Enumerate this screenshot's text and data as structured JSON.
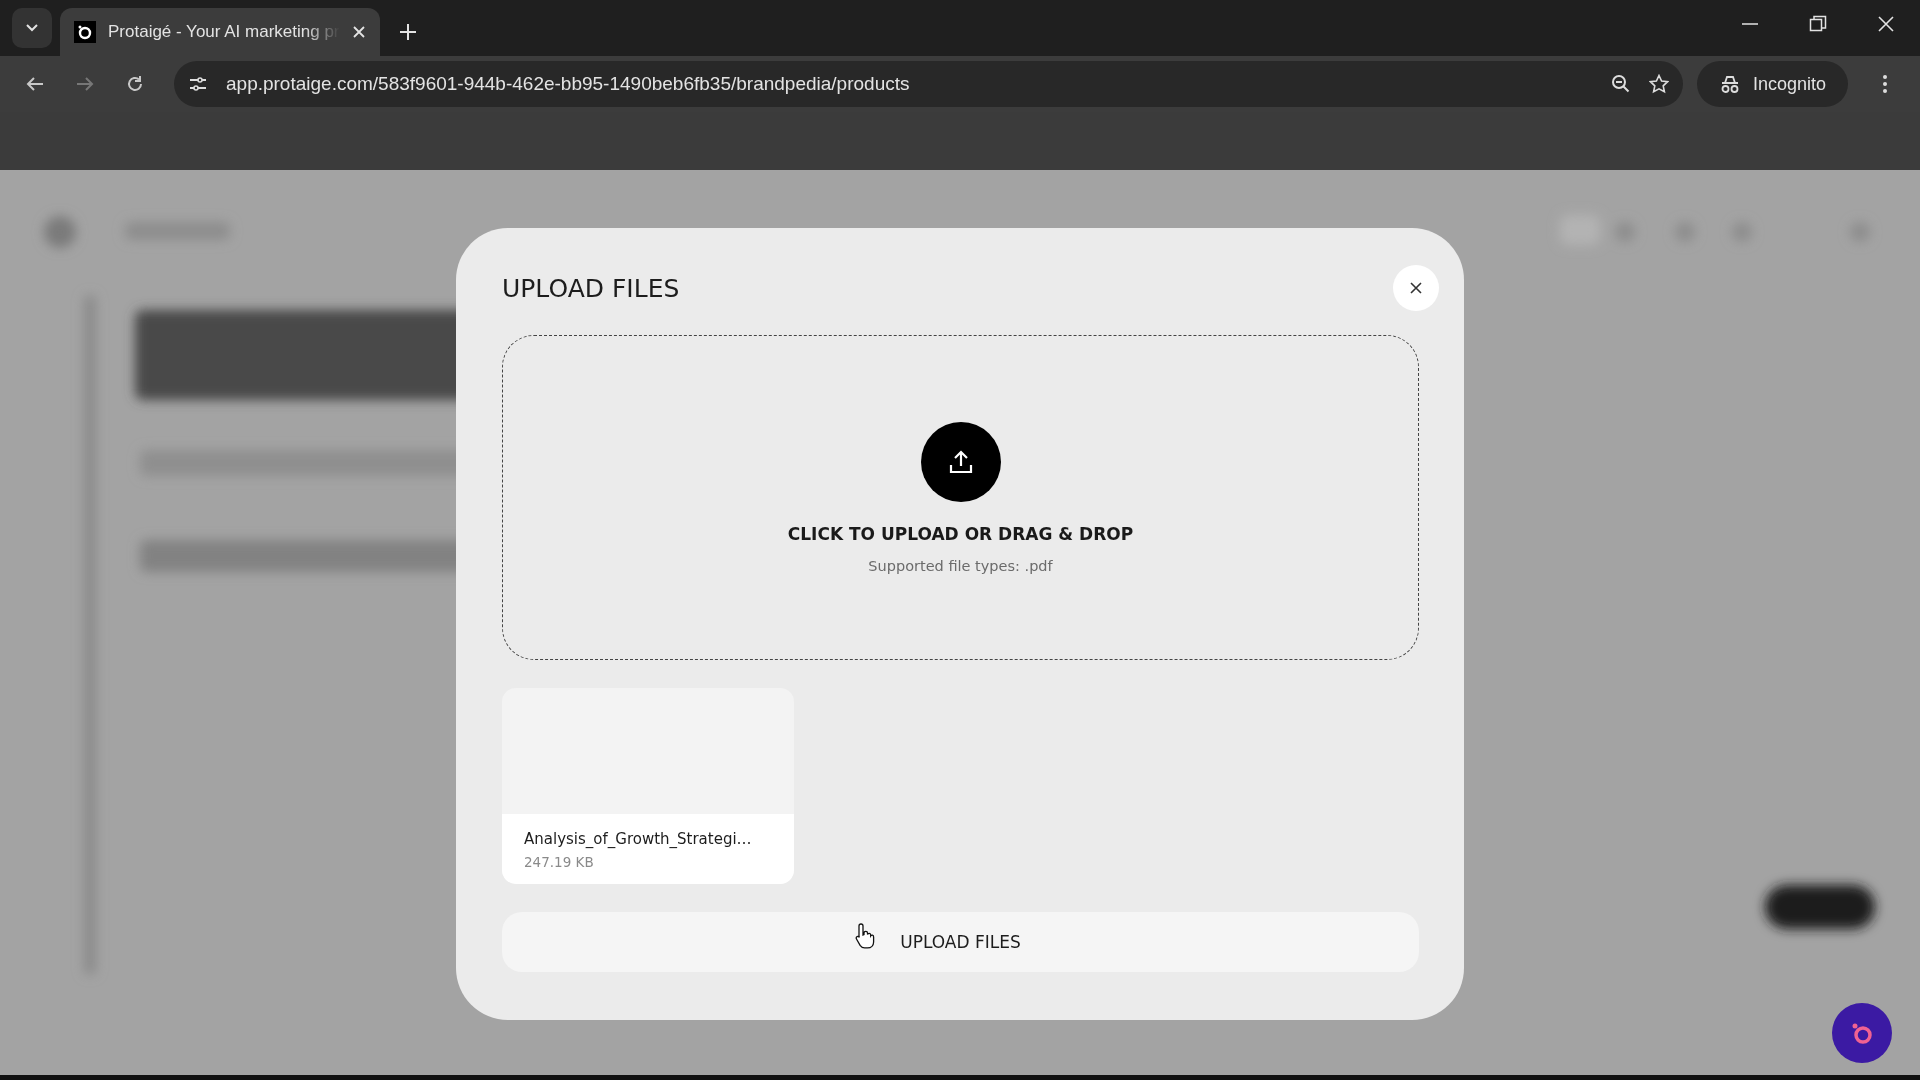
{
  "browser": {
    "tabs": [
      {
        "title": "Protaigé - Your AI marketing pr",
        "selected": true
      }
    ],
    "address": "app.protaige.com/583f9601-944b-462e-bb95-1490beb6fb35/brandpedia/products",
    "profile": "Incognito"
  },
  "dialog": {
    "title": "UPLOAD FILES",
    "dropzone": {
      "heading": "CLICK TO UPLOAD OR DRAG & DROP",
      "hint": "Supported file types: .pdf"
    },
    "files": [
      {
        "name": "Analysis_of_Growth_Strategi…",
        "size": "247.19 KB"
      }
    ],
    "submit": "UPLOAD FILES"
  }
}
